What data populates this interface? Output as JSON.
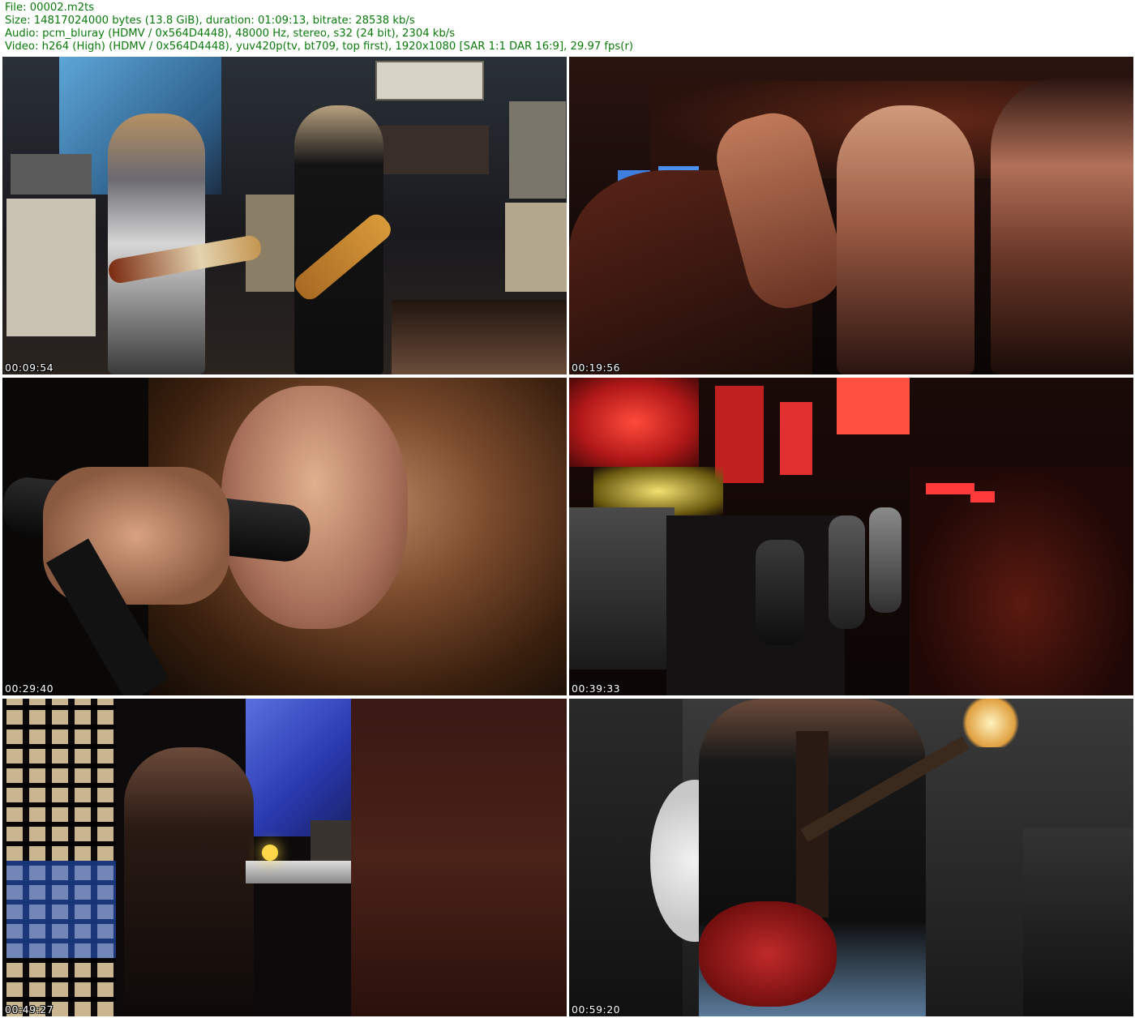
{
  "header": {
    "file": "File: 00002.m2ts",
    "size": "Size: 14817024000 bytes (13.8 GiB), duration: 01:09:13, bitrate: 28538 kb/s",
    "audio": "Audio: pcm_bluray (HDMV / 0x564D4448), 48000 Hz, stereo, s32 (24 bit), 2304 kb/s",
    "video": "Video: h264 (High) (HDMV / 0x564D4448), yuv420p(tv, bt709, top first), 1920x1080 [SAR 1:1 DAR 16:9], 29.97 fps(r)"
  },
  "thumbnails": [
    {
      "timestamp": "00:09:54"
    },
    {
      "timestamp": "00:19:56"
    },
    {
      "timestamp": "00:29:40"
    },
    {
      "timestamp": "00:39:33"
    },
    {
      "timestamp": "00:49:27"
    },
    {
      "timestamp": "00:59:20"
    }
  ],
  "colors": {
    "header_text": "#0a7a0a",
    "background": "#ffffff",
    "timestamp_text": "#ffffff"
  }
}
